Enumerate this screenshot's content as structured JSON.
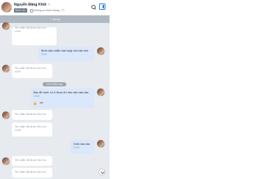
{
  "header": {
    "name": "Nguyễn Đăng Khôi",
    "edit_icon": "edit-icon",
    "tag_label": "Khối Lớn",
    "extra_label": "Không có nhóm chung",
    "extra_sep": "|",
    "search_icon": "search-icon",
    "panel_icon": "toggle-panel-icon"
  },
  "pinbar": {
    "label": "Bỏ tìm",
    "icon": "pin-icon"
  },
  "messages": [
    {
      "dir": "in",
      "text": "Tin nhắn đã được thu hồi",
      "time": "13:01"
    },
    {
      "dir": "out",
      "text": "Mình cảm nhắc mai reply cho bác nhé",
      "time": "13:01"
    },
    {
      "dir": "in",
      "text": "Tin nhắn đã được thu hồi",
      "time": "13:03"
    },
    {
      "dir": "out",
      "text": "Bác để mình 1h-4 được thì vào việc nào bác",
      "time": "13:03"
    },
    {
      "dir": "in",
      "text": "Tin nhắn đã được thu hồi",
      "time": "13:44"
    },
    {
      "dir": "in",
      "text": "Tin nhắn đã được thu hồi",
      "time": "13:46"
    },
    {
      "dir": "out",
      "text": "Chốt nào bác",
      "time": "13:53"
    },
    {
      "dir": "in",
      "text": "Tin nhắn đã được thu hồi",
      "time": ""
    }
  ],
  "date_separator": "13:21 Hôm nay",
  "reaction": {
    "icon": "like-icon",
    "count": "2",
    "emoji": "❤"
  },
  "scroll_icon": "scroll-down-icon",
  "colors": {
    "accent": "#1a73e8",
    "chat_bg": "#e7eaee",
    "out_bubble": "#dbe7fb",
    "tag": "#6b7887"
  }
}
